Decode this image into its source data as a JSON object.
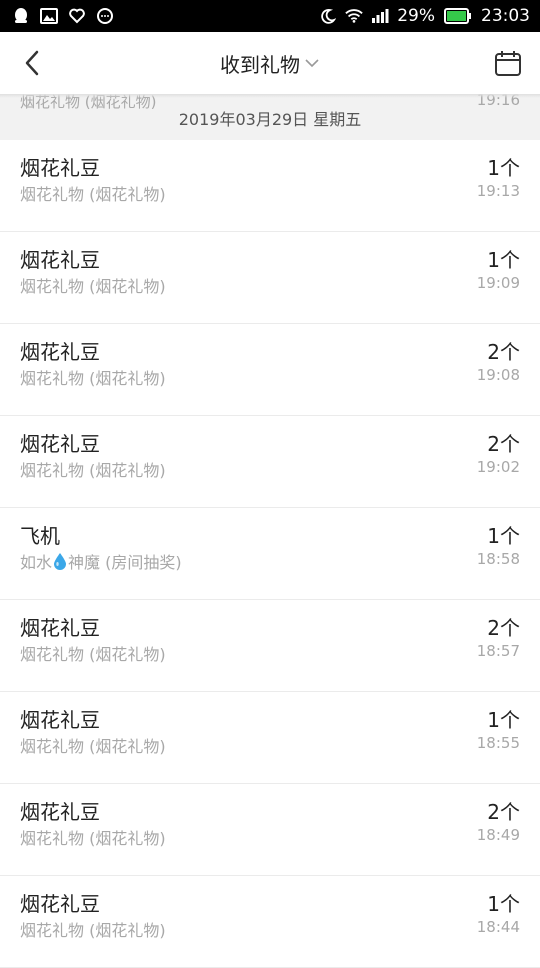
{
  "status_bar": {
    "battery": "29%",
    "time": "23:03",
    "icons": [
      "qq-icon",
      "image-icon",
      "heart-shield-icon",
      "chat-bubble-icon",
      "moon-icon",
      "wifi-icon",
      "signal-icon",
      "battery-icon"
    ]
  },
  "header": {
    "title": "收到礼物",
    "back_icon": "chevron-left-icon",
    "dropdown_icon": "chevron-down-icon",
    "calendar_icon": "calendar-icon"
  },
  "previous_item": {
    "sub": "烟花礼物 (烟花礼物)",
    "time": "19:16"
  },
  "date_header": "2019年03月29日 星期五",
  "items": [
    {
      "name": "烟花礼豆",
      "sub": "烟花礼物 (烟花礼物)",
      "count": "1个",
      "time": "19:13"
    },
    {
      "name": "烟花礼豆",
      "sub": "烟花礼物 (烟花礼物)",
      "count": "1个",
      "time": "19:09"
    },
    {
      "name": "烟花礼豆",
      "sub": "烟花礼物 (烟花礼物)",
      "count": "2个",
      "time": "19:08"
    },
    {
      "name": "烟花礼豆",
      "sub": "烟花礼物 (烟花礼物)",
      "count": "2个",
      "time": "19:02"
    },
    {
      "name": "飞机",
      "sub_prefix": "如水",
      "sub_suffix": "神魔 (房间抽奖)",
      "count": "1个",
      "time": "18:58"
    },
    {
      "name": "烟花礼豆",
      "sub": "烟花礼物 (烟花礼物)",
      "count": "2个",
      "time": "18:57"
    },
    {
      "name": "烟花礼豆",
      "sub": "烟花礼物 (烟花礼物)",
      "count": "1个",
      "time": "18:55"
    },
    {
      "name": "烟花礼豆",
      "sub": "烟花礼物 (烟花礼物)",
      "count": "2个",
      "time": "18:49"
    },
    {
      "name": "烟花礼豆",
      "sub": "烟花礼物 (烟花礼物)",
      "count": "1个",
      "time": "18:44"
    }
  ],
  "colors": {
    "status_bar_bg": "#000000",
    "battery_green": "#35c94a",
    "drop_blue": "#3ba7e8",
    "secondary_text": "#a8a8a8"
  }
}
